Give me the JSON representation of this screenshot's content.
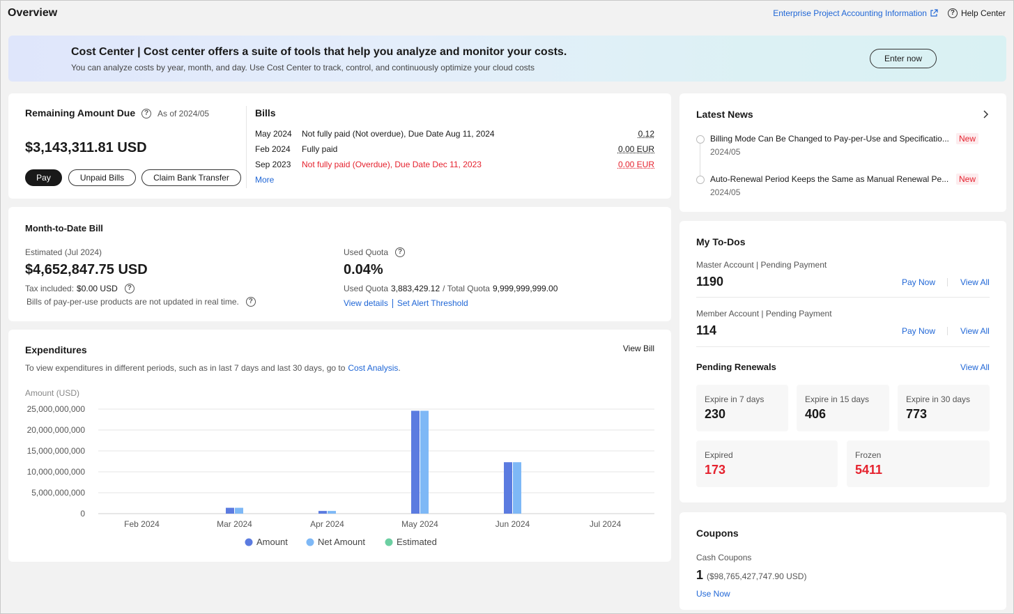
{
  "header": {
    "title": "Overview",
    "enterprise_link": "Enterprise Project Accounting Information",
    "help_center": "Help Center"
  },
  "banner": {
    "title": "Cost Center | Cost center offers a suite of tools that help you analyze and monitor your costs.",
    "subtitle": "You can analyze costs by year, month, and day. Use Cost Center to track, control, and continuously optimize your cloud costs",
    "button": "Enter now"
  },
  "remaining": {
    "title": "Remaining Amount Due",
    "as_of": "As of 2024/05",
    "amount": "$3,143,311.81 USD",
    "pay": "Pay",
    "unpaid_bills": "Unpaid Bills",
    "claim": "Claim Bank Transfer"
  },
  "bills": {
    "title": "Bills",
    "rows": [
      {
        "month": "May 2024",
        "status": "Not fully paid (Not overdue), Due Date Aug 11, 2024",
        "amount": "0.12",
        "overdue": false
      },
      {
        "month": "Feb 2024",
        "status": "Fully paid",
        "amount": "0.00 EUR",
        "overdue": false
      },
      {
        "month": "Sep 2023",
        "status": "Not fully paid (Overdue), Due Date Dec 11, 2023",
        "amount": "0.00 EUR",
        "overdue": true
      }
    ],
    "more": "More"
  },
  "mtd": {
    "title": "Month-to-Date Bill",
    "estimated_label": "Estimated (Jul 2024)",
    "estimated_value": "$4,652,847.75 USD",
    "tax_label": "Tax included:",
    "tax_value": "$0.00 USD",
    "note": "Bills of pay-per-use products are not updated in real time.",
    "quota_label": "Used Quota",
    "quota_pct": "0.04%",
    "used_quota_label": "Used Quota",
    "used_quota_value": "3,883,429.12",
    "total_quota_label": "/ Total Quota",
    "total_quota_value": "9,999,999,999.00",
    "view_details": "View details",
    "set_alert": "Set Alert Threshold"
  },
  "expenditures": {
    "title": "Expenditures",
    "view_bill": "View Bill",
    "desc": "To view expenditures in different periods, such as in last 7 days and last 30 days, go to",
    "desc_link": "Cost Analysis",
    "desc_end": "."
  },
  "chart_data": {
    "type": "bar",
    "title": "",
    "ylabel": "Amount (USD)",
    "xlabel": "",
    "categories": [
      "Feb 2024",
      "Mar 2024",
      "Apr 2024",
      "May 2024",
      "Jun 2024",
      "Jul 2024"
    ],
    "series": [
      {
        "name": "Amount",
        "color": "#5b7be0",
        "values": [
          0,
          1400000000,
          650000000,
          24600000000,
          12300000000,
          0
        ]
      },
      {
        "name": "Net Amount",
        "color": "#7eb8f6",
        "values": [
          0,
          1400000000,
          650000000,
          24600000000,
          12300000000,
          0
        ]
      },
      {
        "name": "Estimated",
        "color": "#6ccfa2",
        "values": [
          0,
          0,
          0,
          0,
          0,
          0
        ]
      }
    ],
    "yticks": [
      "25,000,000,000",
      "20,000,000,000",
      "15,000,000,000",
      "10,000,000,000",
      "5,000,000,000",
      "0"
    ],
    "ylim": [
      0,
      25000000000
    ],
    "grid": true,
    "legend": "bottom"
  },
  "news": {
    "title": "Latest News",
    "items": [
      {
        "title": "Billing Mode Can Be Changed to Pay-per-Use and Specificatio...",
        "date": "2024/05",
        "badge": "New"
      },
      {
        "title": "Auto-Renewal Period Keeps the Same as Manual Renewal Pe...",
        "date": "2024/05",
        "badge": "New"
      }
    ]
  },
  "todos": {
    "title": "My To-Dos",
    "master_label": "Master Account | Pending Payment",
    "master_value": "1190",
    "member_label": "Member Account | Pending Payment",
    "member_value": "114",
    "pay_now": "Pay Now",
    "view_all": "View All",
    "renewals_title": "Pending Renewals",
    "renewals_view_all": "View All",
    "tiles": [
      {
        "label": "Expire in 7 days",
        "value": "230"
      },
      {
        "label": "Expire in 15 days",
        "value": "406"
      },
      {
        "label": "Expire in 30 days",
        "value": "773"
      },
      {
        "label": "Expired",
        "value": "173"
      },
      {
        "label": "Frozen",
        "value": "5411"
      }
    ]
  },
  "coupons": {
    "title": "Coupons",
    "cash_label": "Cash Coupons",
    "count": "1",
    "amount": "($98,765,427,747.90 USD)",
    "use_now": "Use Now"
  }
}
